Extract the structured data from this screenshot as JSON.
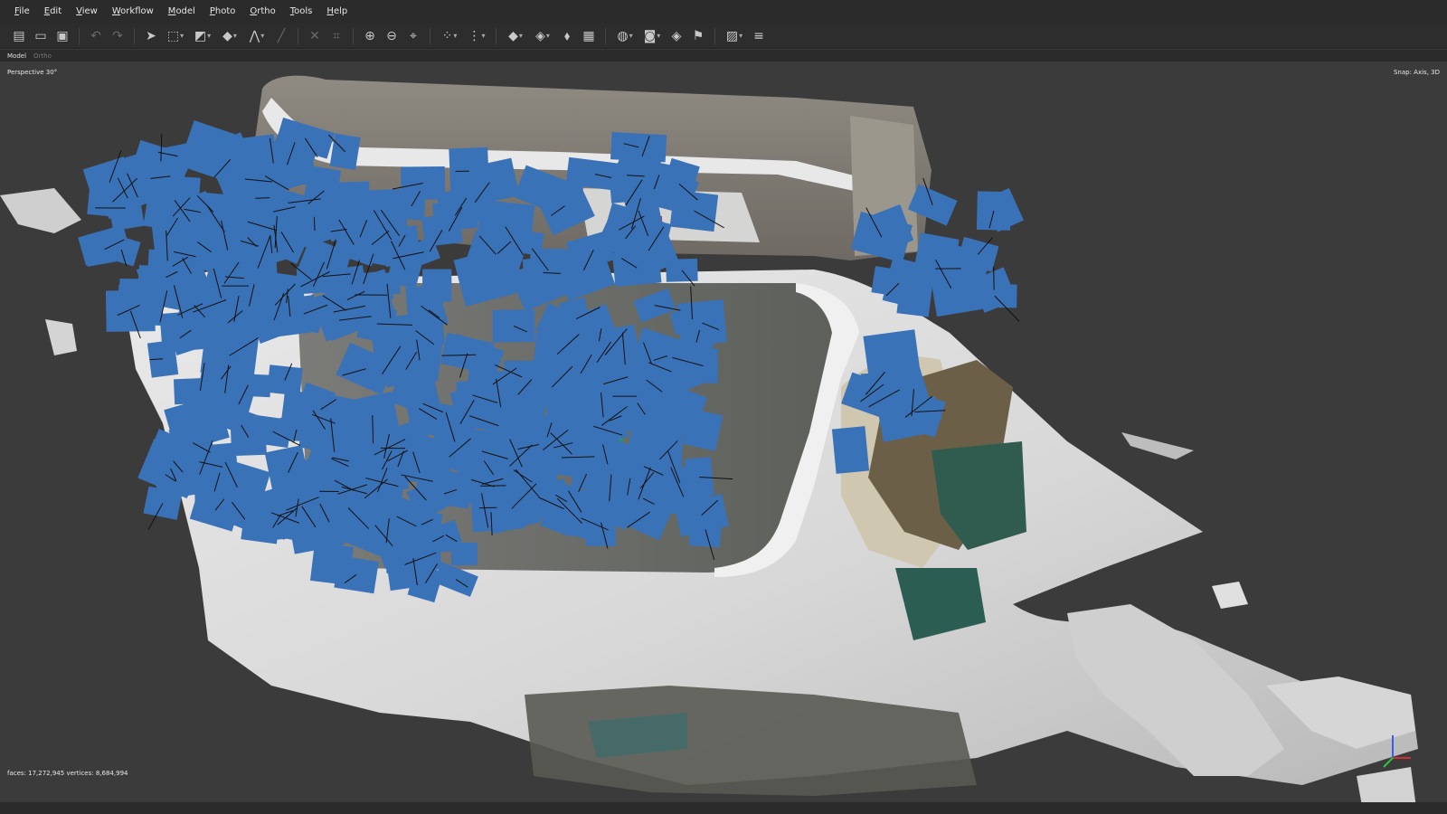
{
  "menu": [
    "File",
    "Edit",
    "View",
    "Workflow",
    "Model",
    "Photo",
    "Ortho",
    "Tools",
    "Help"
  ],
  "toolbar": [
    {
      "icon": "new-document-icon",
      "glyph": "▤"
    },
    {
      "icon": "open-folder-icon",
      "glyph": "▭"
    },
    {
      "icon": "save-icon",
      "glyph": "▣"
    },
    {
      "icon": "undo-icon",
      "glyph": "↶"
    },
    {
      "icon": "redo-icon",
      "glyph": "↷"
    },
    {
      "icon": "navigation-arrow-icon",
      "glyph": "➤"
    },
    {
      "icon": "rectangle-selection-icon",
      "glyph": "⬚"
    },
    {
      "icon": "shape-selection-icon",
      "glyph": "◩"
    },
    {
      "icon": "draw-polygon-icon",
      "glyph": "◆"
    },
    {
      "icon": "draw-polyline-icon",
      "glyph": "⋀"
    },
    {
      "icon": "ruler-icon",
      "glyph": "╱"
    },
    {
      "icon": "delete-icon",
      "glyph": "✕"
    },
    {
      "icon": "crop-icon",
      "glyph": "⌗"
    },
    {
      "icon": "zoom-in-icon",
      "glyph": "⊕"
    },
    {
      "icon": "zoom-out-icon",
      "glyph": "⊖"
    },
    {
      "icon": "reset-view-icon",
      "glyph": "⌖"
    },
    {
      "icon": "show-points-icon",
      "glyph": "⁘"
    },
    {
      "icon": "show-grid-icon",
      "glyph": "⋮"
    },
    {
      "icon": "model-mode-icon",
      "glyph": "◆"
    },
    {
      "icon": "shading-icon",
      "glyph": "◈"
    },
    {
      "icon": "tie-points-icon",
      "glyph": "⬧"
    },
    {
      "icon": "texture-icon",
      "glyph": "▦"
    },
    {
      "icon": "globe-icon",
      "glyph": "◍"
    },
    {
      "icon": "camera-icon",
      "glyph": "◙"
    },
    {
      "icon": "shapes-icon",
      "glyph": "◈"
    },
    {
      "icon": "markers-flag-icon",
      "glyph": "⚑"
    },
    {
      "icon": "image-overlay-icon",
      "glyph": "▨"
    },
    {
      "icon": "layers-icon",
      "glyph": "≡"
    }
  ],
  "view_tabs": [
    {
      "label": "Model",
      "active": true
    },
    {
      "label": "Ortho",
      "active": false
    }
  ],
  "viewport": {
    "projection_label": "Perspective 30°",
    "snap_label": "Snap: Axis, 3D",
    "stats_label": "faces: 17,272,945 vertices: 8,684,994"
  },
  "colors": {
    "background": "#3b3b3b",
    "camera_planes": "#3a72b8",
    "menubar": "#2b2b2b"
  }
}
